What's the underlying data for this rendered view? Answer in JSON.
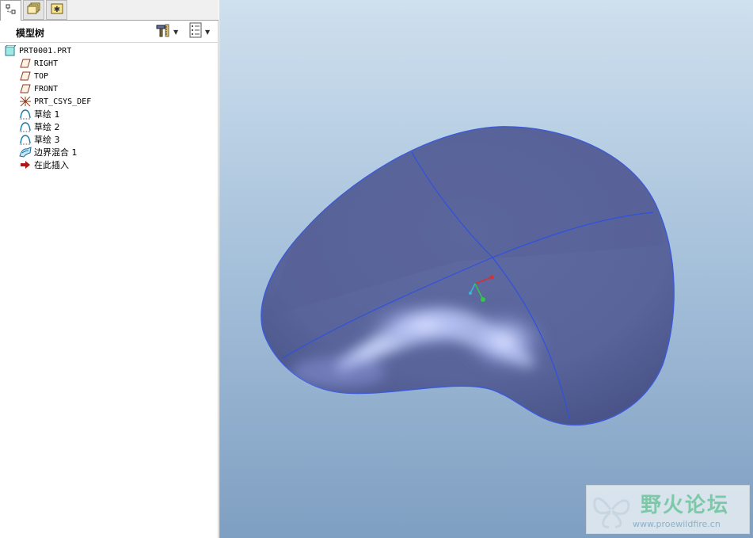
{
  "panel": {
    "title": "模型树",
    "tabs": [
      {
        "name": "model-tree-tab",
        "icon": "tree-icon",
        "active": true
      },
      {
        "name": "folder-browser-tab",
        "icon": "folder-icon",
        "active": false
      },
      {
        "name": "favorites-tab",
        "icon": "favorites-icon",
        "active": false
      }
    ],
    "tools": [
      {
        "name": "settings-tool",
        "icon": "hammer-ruler-icon"
      },
      {
        "name": "show-tool",
        "icon": "list-view-icon"
      }
    ]
  },
  "tree": {
    "items": [
      {
        "label": "PRT0001.PRT",
        "icon": "part-icon"
      },
      {
        "label": "RIGHT",
        "icon": "datum-plane-icon"
      },
      {
        "label": "TOP",
        "icon": "datum-plane-icon"
      },
      {
        "label": "FRONT",
        "icon": "datum-plane-icon"
      },
      {
        "label": "PRT_CSYS_DEF",
        "icon": "csys-icon"
      },
      {
        "label": "草绘 1",
        "icon": "sketch-icon"
      },
      {
        "label": "草绘 2",
        "icon": "sketch-icon"
      },
      {
        "label": "草绘 3",
        "icon": "sketch-icon"
      },
      {
        "label": "边界混合 1",
        "icon": "boundary-blend-icon"
      },
      {
        "label": "在此插入",
        "icon": "insert-here-arrow-icon"
      }
    ]
  },
  "watermark": {
    "title": "野火论坛",
    "url": "www.proewildfire.cn"
  },
  "colors": {
    "surface": "#5c6a9c",
    "surface_edge": "#3d5ad8",
    "highlight": "#c8d4ff",
    "bg_top": "#cfe0ee",
    "bg_bottom": "#7f9fc2"
  }
}
